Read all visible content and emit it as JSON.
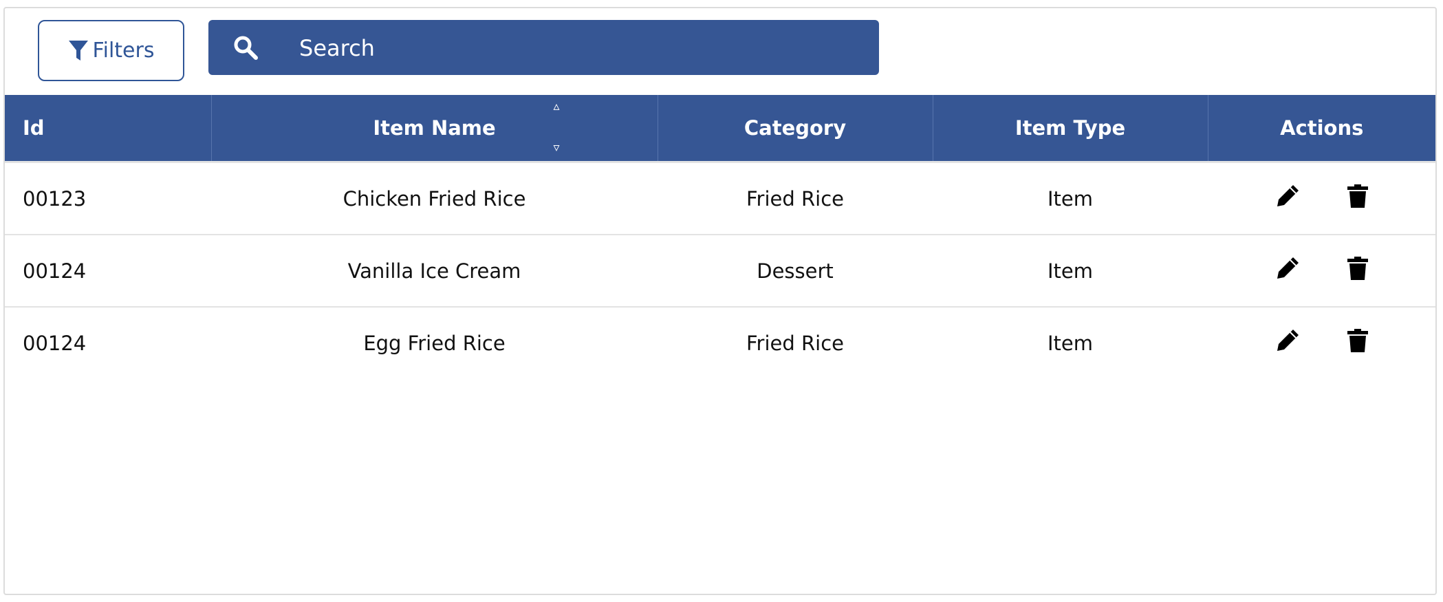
{
  "toolbar": {
    "filters_label": "Filters",
    "search_placeholder": "Search"
  },
  "table": {
    "headers": {
      "id": "Id",
      "item_name": "Item Name",
      "category": "Category",
      "item_type": "Item Type",
      "actions": "Actions"
    },
    "sort": {
      "up_glyph": "▵",
      "down_glyph": "▿"
    },
    "rows": [
      {
        "id": "00123",
        "item_name": "Chicken Fried Rice",
        "category": "Fried Rice",
        "item_type": "Item"
      },
      {
        "id": "00124",
        "item_name": "Vanilla Ice Cream",
        "category": "Dessert",
        "item_type": "Item"
      },
      {
        "id": "00124",
        "item_name": "Egg Fried Rice",
        "category": "Fried Rice",
        "item_type": "Item"
      }
    ],
    "row_actions": [
      "pencil-icon",
      "trash-icon"
    ]
  },
  "colors": {
    "brand_blue": "#365694",
    "border_blue": "#2f5597",
    "text": "#111111"
  }
}
